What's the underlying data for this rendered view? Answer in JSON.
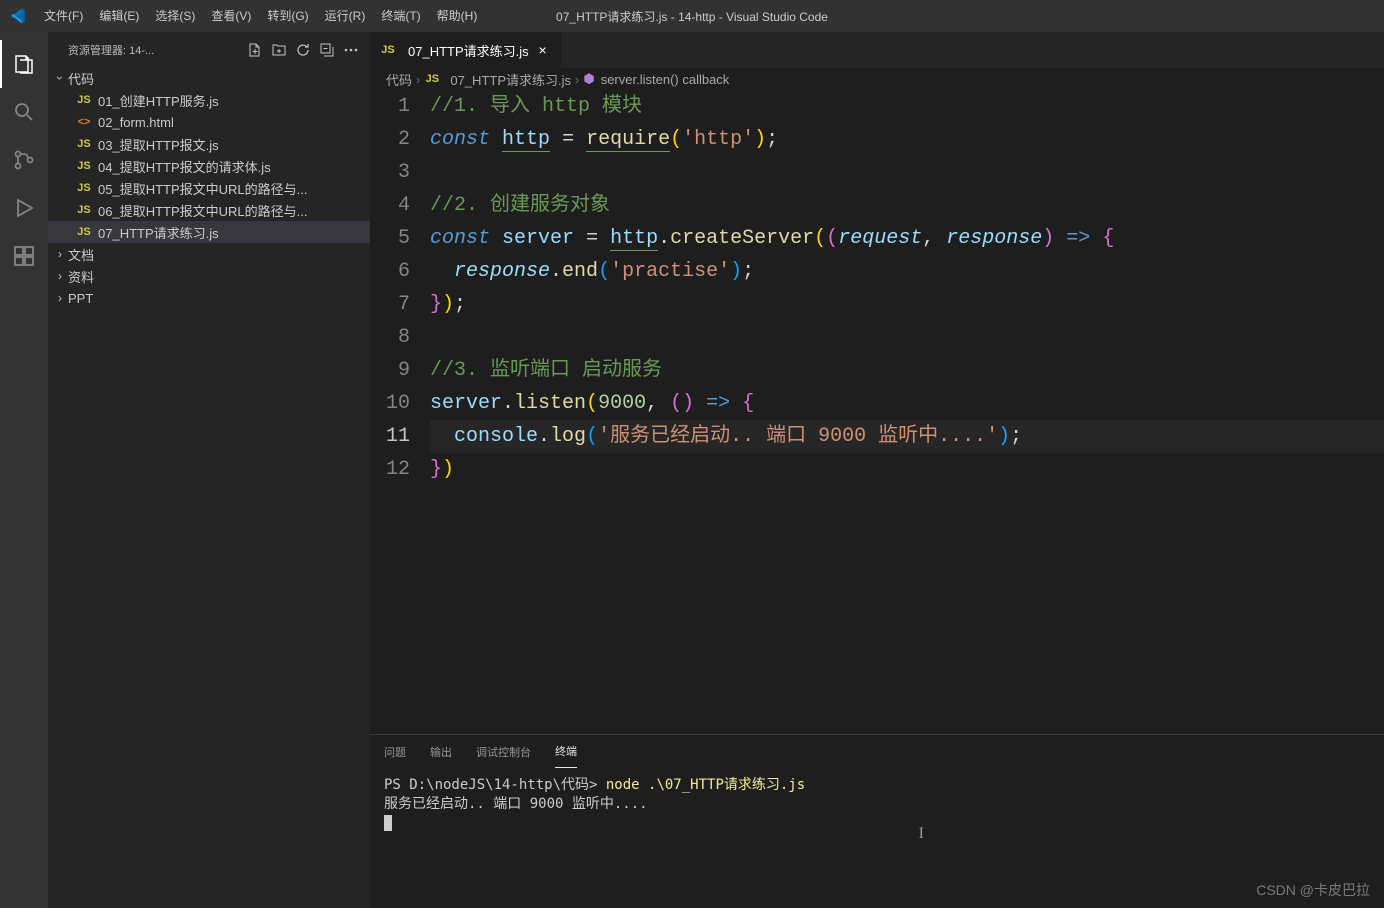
{
  "window": {
    "title": "07_HTTP请求练习.js - 14-http - Visual Studio Code"
  },
  "menu": [
    "文件(F)",
    "编辑(E)",
    "选择(S)",
    "查看(V)",
    "转到(G)",
    "运行(R)",
    "终端(T)",
    "帮助(H)"
  ],
  "sidebar": {
    "title": "资源管理器: 14-...",
    "root": "代码",
    "files": [
      {
        "icon": "JS",
        "iconClass": "js-icon",
        "name": "01_创建HTTP服务.js"
      },
      {
        "icon": "<>",
        "iconClass": "html-icon",
        "name": "02_form.html"
      },
      {
        "icon": "JS",
        "iconClass": "js-icon",
        "name": "03_提取HTTP报文.js"
      },
      {
        "icon": "JS",
        "iconClass": "js-icon",
        "name": "04_提取HTTP报文的请求体.js"
      },
      {
        "icon": "JS",
        "iconClass": "js-icon",
        "name": "05_提取HTTP报文中URL的路径与..."
      },
      {
        "icon": "JS",
        "iconClass": "js-icon",
        "name": "06_提取HTTP报文中URL的路径与..."
      },
      {
        "icon": "JS",
        "iconClass": "js-icon",
        "name": "07_HTTP请求练习.js"
      }
    ],
    "folders": [
      "文档",
      "资料",
      "PPT"
    ]
  },
  "tab": {
    "icon": "JS",
    "name": "07_HTTP请求练习.js"
  },
  "breadcrumb": {
    "part1": "代码",
    "part2": "07_HTTP请求练习.js",
    "part3": "server.listen() callback"
  },
  "code": {
    "comment1": "//1. 导入 http 模块",
    "comment2": "//2. 创建服务对象",
    "comment3": "//3. 监听端口 启动服务",
    "const": "const",
    "http": "http",
    "require": "require",
    "httpStr": "'http'",
    "server": "server",
    "createServer": "createServer",
    "request": "request",
    "response": "response",
    "end": "end",
    "practiseStr": "'practise'",
    "listen": "listen",
    "port": "9000",
    "console": "console",
    "log": "log",
    "logStr": "'服务已经启动.. 端口 9000 监听中....'"
  },
  "lineNumbers": [
    "1",
    "2",
    "3",
    "4",
    "5",
    "6",
    "7",
    "8",
    "9",
    "10",
    "11",
    "12"
  ],
  "panel": {
    "tabs": [
      "问题",
      "输出",
      "调试控制台",
      "终端"
    ],
    "activeTab": 3,
    "prompt": "PS D:\\nodeJS\\14-http\\代码> ",
    "command": "node .\\07_HTTP请求练习.js",
    "output": "服务已经启动.. 端口 9000 监听中...."
  },
  "watermark": "CSDN @卡皮巴拉"
}
